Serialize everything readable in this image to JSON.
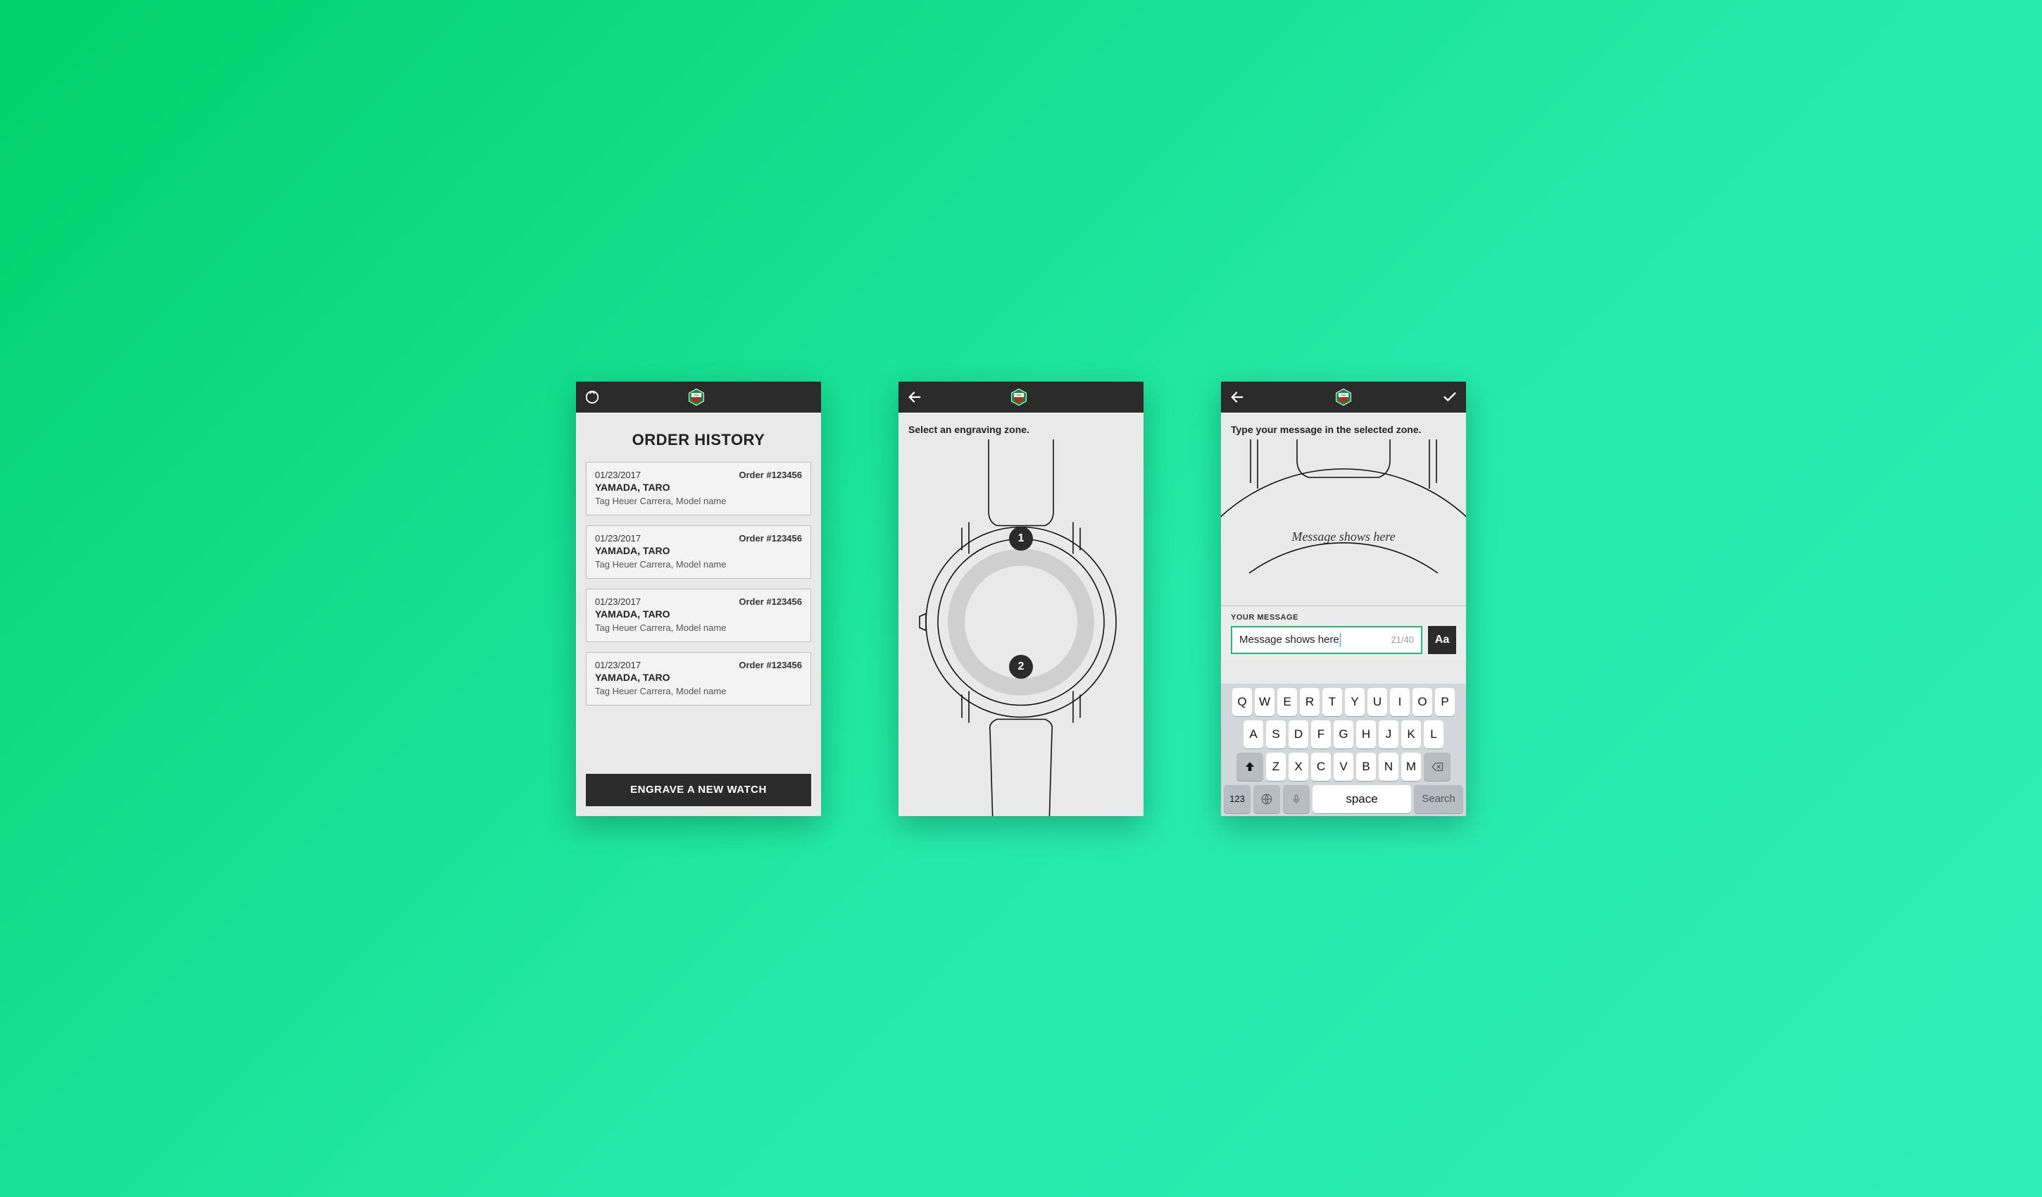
{
  "brand_colors": {
    "accent": "#1fbf7a",
    "header": "#2b2b2b"
  },
  "screen1": {
    "title": "ORDER HISTORY",
    "cta": "ENGRAVE A NEW WATCH",
    "orders": [
      {
        "date": "01/23/2017",
        "order_no": "Order #123456",
        "name": "YAMADA, TARO",
        "desc": "Tag Heuer Carrera, Model name"
      },
      {
        "date": "01/23/2017",
        "order_no": "Order #123456",
        "name": "YAMADA, TARO",
        "desc": "Tag Heuer Carrera, Model name"
      },
      {
        "date": "01/23/2017",
        "order_no": "Order #123456",
        "name": "YAMADA, TARO",
        "desc": "Tag Heuer Carrera, Model name"
      },
      {
        "date": "01/23/2017",
        "order_no": "Order #123456",
        "name": "YAMADA, TARO",
        "desc": "Tag Heuer Carrera, Model name"
      }
    ]
  },
  "screen2": {
    "instruction": "Select an engraving zone.",
    "zones": [
      {
        "label": "1"
      },
      {
        "label": "2"
      }
    ]
  },
  "screen3": {
    "instruction": "Type your message in the selected zone.",
    "preview_text": "Message shows here",
    "form": {
      "label": "YOUR MESSAGE",
      "value": "Message shows here",
      "counter": "21/40",
      "font_button": "Aa"
    },
    "keyboard": {
      "row1": [
        "Q",
        "W",
        "E",
        "R",
        "T",
        "Y",
        "U",
        "I",
        "O",
        "P"
      ],
      "row2": [
        "A",
        "S",
        "D",
        "F",
        "G",
        "H",
        "J",
        "K",
        "L"
      ],
      "row3": [
        "Z",
        "X",
        "C",
        "V",
        "B",
        "N",
        "M"
      ],
      "numbers": "123",
      "space": "space",
      "search": "Search"
    }
  }
}
